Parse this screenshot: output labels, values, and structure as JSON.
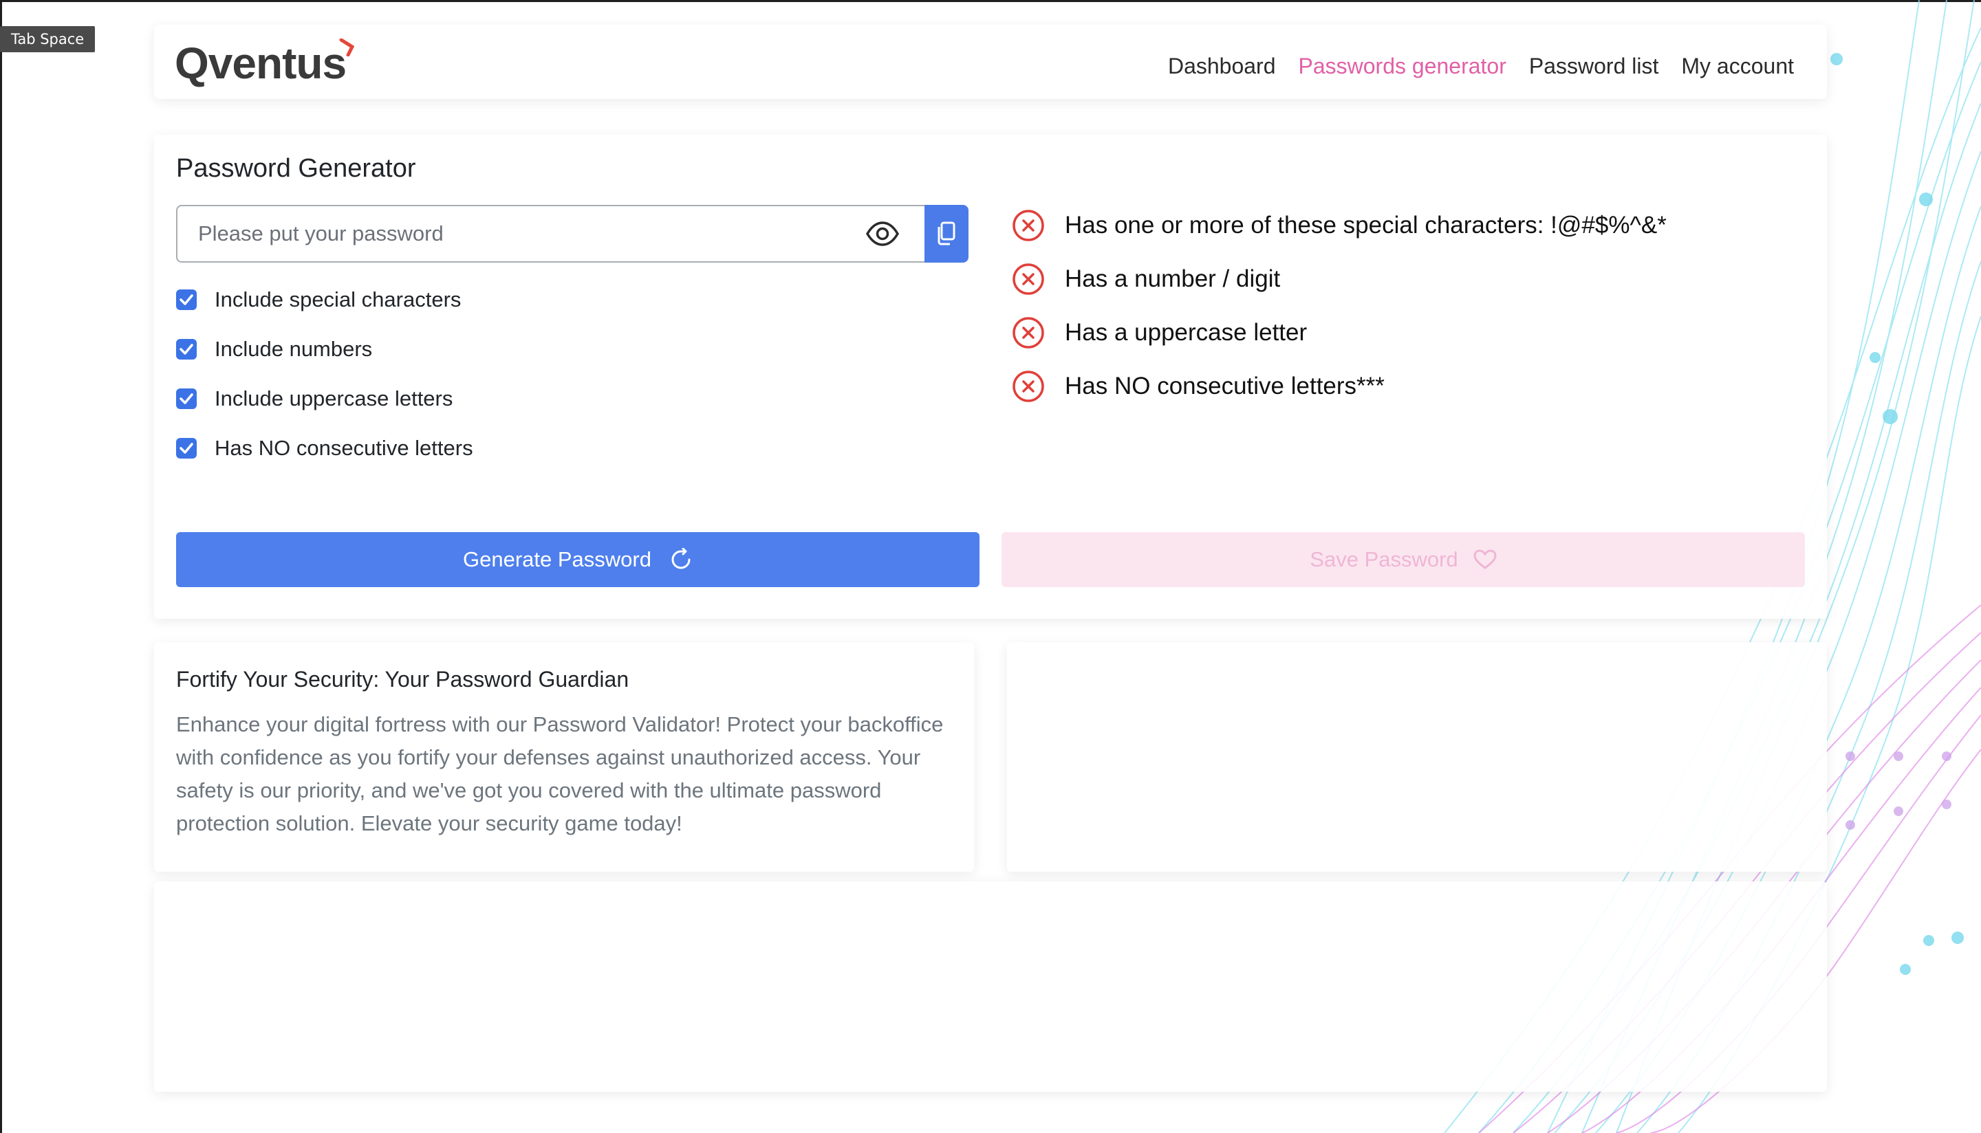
{
  "tooltip": {
    "label": "Tab Space"
  },
  "brand": {
    "name": "Qventus",
    "mark_color": "#e4473a"
  },
  "nav": {
    "items": [
      {
        "label": "Dashboard",
        "active": false
      },
      {
        "label": "Passwords generator",
        "active": true
      },
      {
        "label": "Password list",
        "active": false
      },
      {
        "label": "My account",
        "active": false
      }
    ],
    "active_color": "#e160a5"
  },
  "generator": {
    "title": "Password Generator",
    "password_input": {
      "value": "",
      "placeholder": "Please put your password"
    },
    "visibility_icon": "eye-icon",
    "copy_icon": "copy-icon",
    "options": [
      {
        "label": "Include special characters",
        "checked": true
      },
      {
        "label": "Include numbers",
        "checked": true
      },
      {
        "label": "Include uppercase letters",
        "checked": true
      },
      {
        "label": "Has NO consecutive letters",
        "checked": true
      }
    ],
    "rules": [
      {
        "label": "Has one or more of these special characters: !@#$%^&*",
        "passed": false
      },
      {
        "label": "Has a number / digit",
        "passed": false
      },
      {
        "label": "Has a uppercase letter",
        "passed": false
      },
      {
        "label": "Has NO consecutive letters***",
        "passed": false
      }
    ],
    "generate_button": {
      "label": "Generate Password",
      "icon": "refresh-icon"
    },
    "save_button": {
      "label": "Save Password",
      "icon": "heart-icon",
      "disabled": true
    }
  },
  "info": {
    "title": "Fortify Your Security: Your Password Guardian",
    "body": "Enhance your digital fortress with our Password Validator! Protect your backoffice with confidence as you fortify your defenses against unauthorized access. Your safety is our priority, and we've got you covered with the ultimate password protection solution. Elevate your security game today!"
  },
  "colors": {
    "primary": "#4e7fec",
    "fail": "#e0403a",
    "accent_pink": "#e160a5",
    "save_disabled_bg": "#fbe6f0"
  }
}
